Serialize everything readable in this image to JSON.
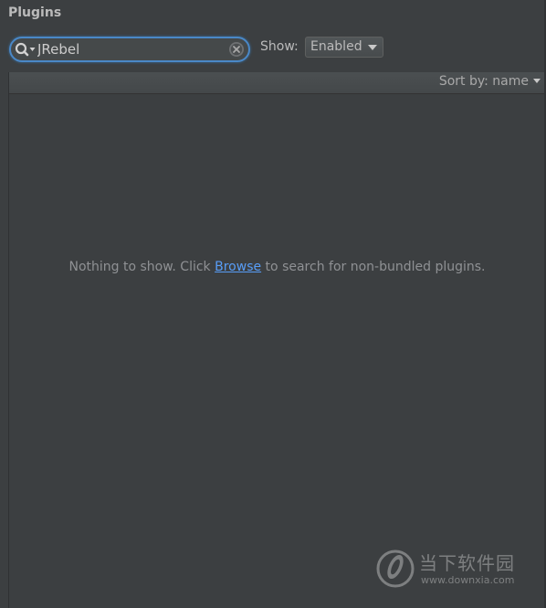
{
  "plugins_panel": {
    "title": "Plugins",
    "search": {
      "value": "JRebel",
      "icon": "search-icon",
      "clear_icon": "clear-icon"
    },
    "show_filter": {
      "label": "Show:",
      "selected": "Enabled"
    },
    "sort": {
      "label": "Sort by: name"
    },
    "empty_state": {
      "before_link": "Nothing to show. Click ",
      "link_text": "Browse",
      "after_link": " to search for non-bundled plugins."
    }
  },
  "watermark": {
    "name": "当下软件园",
    "url": "www.downxia.com"
  },
  "colors": {
    "background": "#3c3f41",
    "focus_border": "#4a88c7",
    "link": "#589df6",
    "text": "#bbbbbb",
    "muted_text": "#8f9194"
  }
}
